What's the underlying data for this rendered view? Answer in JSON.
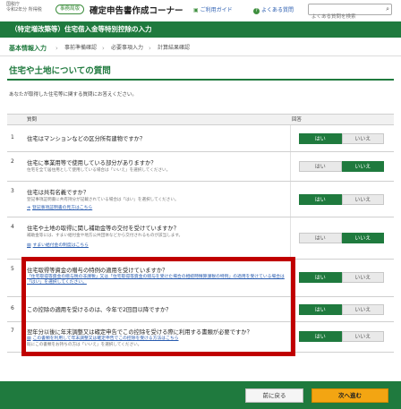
{
  "header": {
    "era": "国税庁",
    "year": "令和2年分",
    "tax_type": "所得税",
    "badge": "事務局版",
    "title": "確定申告書作成コーナー",
    "guide_link": "ご利用ガイド",
    "faq_link": "よくある質問",
    "search_placeholder": "よくある質問を検索"
  },
  "banner": "（特定増改築等）住宅借入金等特別控除の入力",
  "steps": [
    {
      "label": "基本情報入力",
      "active": true
    },
    {
      "label": "事前準備確認",
      "active": false
    },
    {
      "label": "必要事項入力",
      "active": false
    },
    {
      "label": "計算結果確認",
      "active": false
    }
  ],
  "page_title": "住宅や土地についての質問",
  "intro": "あなたが取得した住宅等に関する質問にお答えください。",
  "table": {
    "col_question": "質問",
    "col_answer": "回答",
    "rows": [
      {
        "num": "1",
        "question": "住宅はマンションなどの区分所有建物ですか？",
        "yes": "はい",
        "no": "いいえ",
        "selected": "yes"
      },
      {
        "num": "2",
        "question": "住宅に事業用等で使用している部分がありますか？",
        "note": "住宅を全て居住用として使用している場合は「いいえ」を選択してください。",
        "yes": "はい",
        "no": "いいえ",
        "selected": "no"
      },
      {
        "num": "3",
        "question": "住宅は共有名義ですか？",
        "note": "登記事項証明書に共有持分が記載されている場合は「はい」を選択してください。",
        "link": "登記事項証明書の見方はこちら",
        "yes": "はい",
        "no": "いいえ",
        "selected": "yes"
      },
      {
        "num": "4",
        "question": "住宅や土地の取得に関し補助金等の交付を受けていますか？",
        "note": "補助金等には、すまい給付金や地方公共団体などから交付されるものが該当します。",
        "link": "すまい給付金の制度はこちら",
        "yes": "はい",
        "no": "いいえ",
        "selected": "no"
      },
      {
        "num": "5",
        "question": "住宅取得等資金の贈与の特例の適用を受けていますか？",
        "link": "「住宅取得等資金の贈与税の非課税」又は「住宅取得等資金の贈与を受けた場合の相続時精算課税の特例」の適用を受けている場合は「はい」を選択してください。",
        "yes": "はい",
        "no": "いいえ",
        "selected": "yes"
      },
      {
        "num": "6",
        "question": "この控除の適用を受けるのは、今年で2回目以降ですか？",
        "yes": "はい",
        "no": "いいえ",
        "selected": "yes"
      },
      {
        "num": "7",
        "question": "翌年分以後に年末調整又は確定申告でこの控除を受ける際に利用する書類が必要ですか？",
        "link": "この書類を利用して年末調整又は確定申告でこの控除を受ける方法はこちら",
        "note": "既にこの書類をお持ちの方は「いいえ」を選択してください。",
        "yes": "はい",
        "no": "いいえ",
        "selected": "yes"
      }
    ]
  },
  "footer": {
    "back": "前に戻る",
    "next": "次へ進む"
  },
  "colors": {
    "brand_green": "#1f7a3e",
    "highlight_red": "#c00000",
    "next_orange": "#f3a512"
  }
}
